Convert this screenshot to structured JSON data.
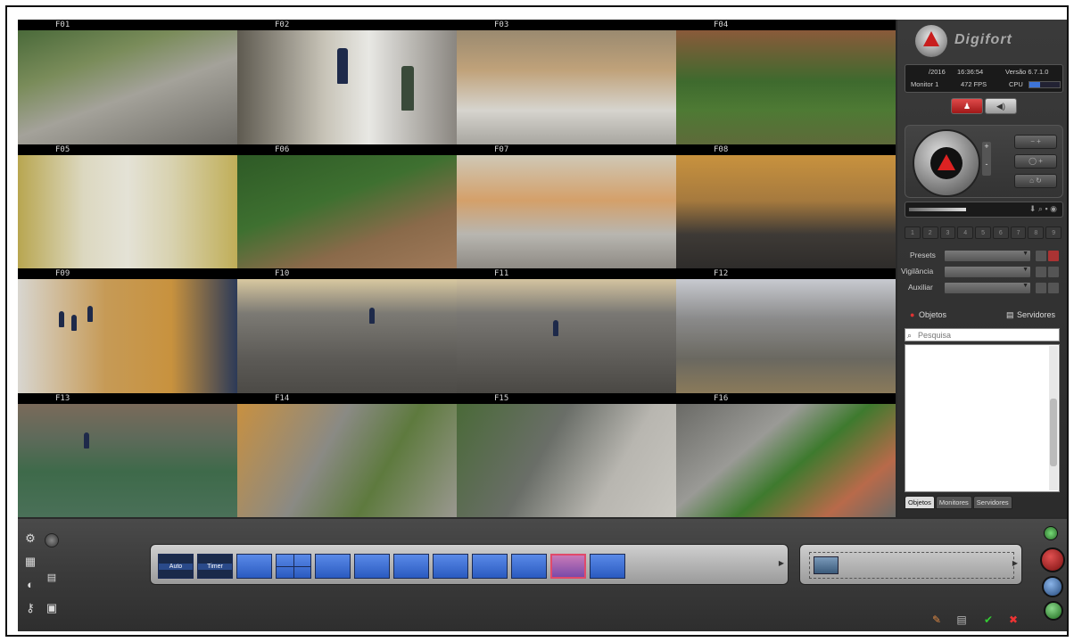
{
  "app": {
    "name": "Digifort"
  },
  "cameras": [
    "F01",
    "F02",
    "F03",
    "F04",
    "F05",
    "F06",
    "F07",
    "F08",
    "F09",
    "F10",
    "F11",
    "F12",
    "F13",
    "F14",
    "F15",
    "F16"
  ],
  "status": {
    "date": "/2016",
    "time": "16:36:54",
    "version": "Versão 6.7.1.0",
    "monitor": "Monitor 1",
    "fps": "472 FPS",
    "cpu_label": "CPU",
    "cpu_level": 0.35
  },
  "ptz": {
    "zoom_plus": "+",
    "zoom_minus": "-"
  },
  "preset_numbers": [
    "1",
    "2",
    "3",
    "4",
    "5",
    "6",
    "7",
    "8",
    "9"
  ],
  "combos": {
    "presets": "Presets",
    "vigilance": "Vigilância",
    "auxiliary": "Auxiliar"
  },
  "objects_panel": {
    "objects_label": "Objetos",
    "servers_label": "Servidores",
    "search_placeholder": "Pesquisa",
    "tabs": [
      "Objetos",
      "Monitores",
      "Servidores"
    ]
  },
  "layouts": {
    "auto_label": "Auto",
    "timer_label": "Timer"
  },
  "colors": {
    "accent_red": "#c81e1e",
    "layout_blue": "#3d74d8",
    "panel_dark": "#2c2c2c"
  }
}
